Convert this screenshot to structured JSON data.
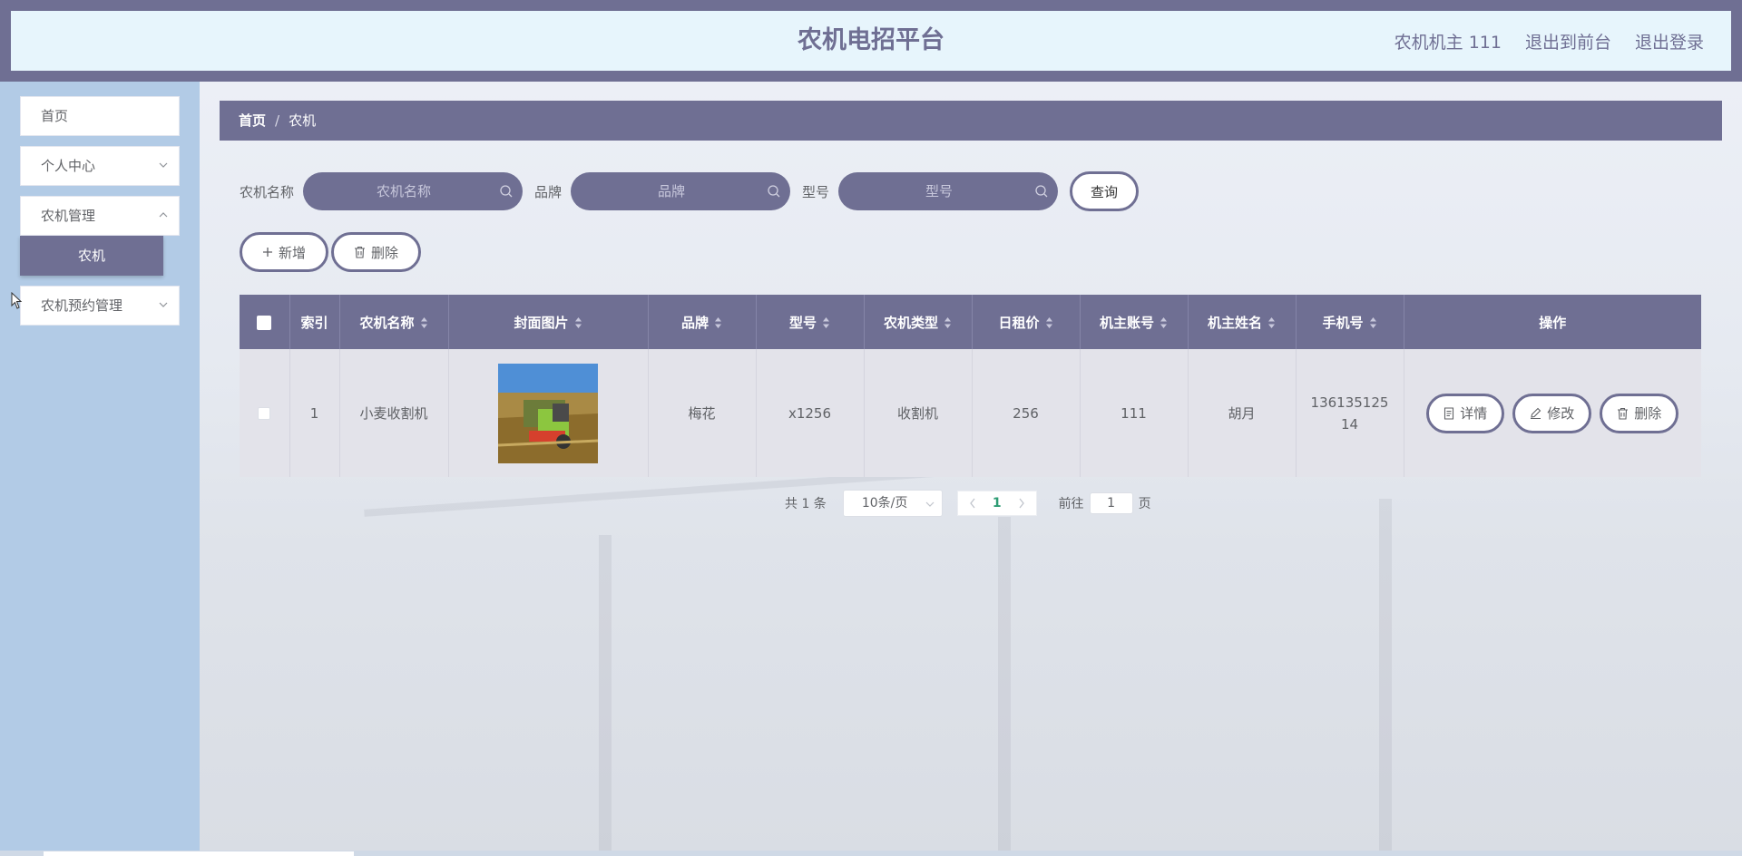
{
  "header": {
    "title": "农机电招平台",
    "user": "农机机主 111",
    "back_front": "退出到前台",
    "logout": "退出登录"
  },
  "sidebar": {
    "items": [
      {
        "label": "首页"
      },
      {
        "label": "个人中心"
      },
      {
        "label": "农机管理"
      },
      {
        "label": "农机预约管理"
      }
    ],
    "active_sub": "农机"
  },
  "breadcrumb": {
    "home": "首页",
    "sep": "/",
    "current": "农机"
  },
  "search": {
    "name_label": "农机名称",
    "name_placeholder": "农机名称",
    "brand_label": "品牌",
    "brand_placeholder": "品牌",
    "model_label": "型号",
    "model_placeholder": "型号",
    "query_btn": "查询"
  },
  "actions": {
    "add": "新增",
    "delete": "删除"
  },
  "table": {
    "headers": [
      "索引",
      "农机名称",
      "封面图片",
      "品牌",
      "型号",
      "农机类型",
      "日租价",
      "机主账号",
      "机主姓名",
      "手机号",
      "操作"
    ],
    "rows": [
      {
        "index": "1",
        "name": "小麦收割机",
        "brand": "梅花",
        "model": "x1256",
        "type": "收割机",
        "price": "256",
        "account": "111",
        "owner": "胡月",
        "phone": "13613512514"
      }
    ],
    "op_detail": "详情",
    "op_edit": "修改",
    "op_delete": "删除"
  },
  "pagination": {
    "total": "共 1 条",
    "page_size": "10条/页",
    "current": "1",
    "goto_label": "前往",
    "goto_value": "1",
    "page_unit": "页"
  },
  "colors": {
    "primary": "#6f6f93",
    "sidebar_bg": "#b2cbe6",
    "header_bg": "#e7f5fc",
    "active_page": "#2e9c74"
  }
}
